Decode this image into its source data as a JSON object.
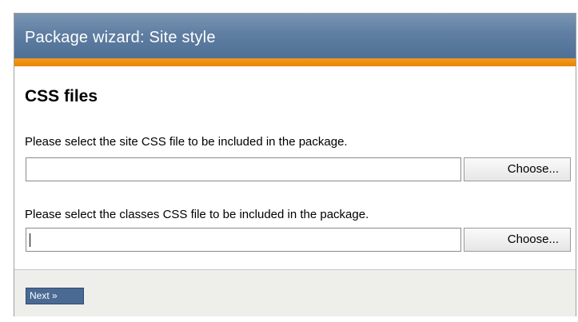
{
  "wizard": {
    "title": "Package wizard: Site style",
    "section_title": "CSS files",
    "site_css": {
      "prompt": "Please select the site CSS file to be included in the package.",
      "value": "",
      "button_label": "Choose..."
    },
    "classes_css": {
      "prompt": "Please select the classes CSS file to be included in the package.",
      "value": "",
      "button_label": "Choose..."
    },
    "next_label": "Next »"
  },
  "colors": {
    "header_blue": "#5f7ea2",
    "accent_orange": "#ef8c00",
    "next_button_blue": "#4a6a93"
  }
}
